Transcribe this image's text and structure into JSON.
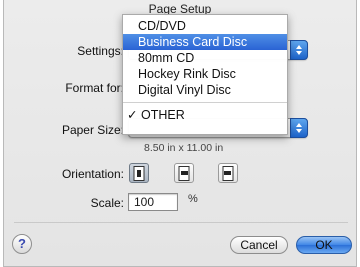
{
  "window": {
    "title": "Page Setup"
  },
  "settings": {
    "label": "Settings:"
  },
  "format_for": {
    "label": "Format for:"
  },
  "paper_size": {
    "label": "Paper Size:",
    "dimensions": "8.50 in x 11.00 in"
  },
  "menu": {
    "items": [
      {
        "label": "CD/DVD"
      },
      {
        "label": "Business Card Disc"
      },
      {
        "label": "80mm CD"
      },
      {
        "label": "Hockey Rink Disc"
      },
      {
        "label": "Digital Vinyl Disc"
      }
    ],
    "checked_item": {
      "check": "✓",
      "label": "OTHER"
    }
  },
  "orientation": {
    "label": "Orientation:"
  },
  "scale": {
    "label": "Scale:",
    "value": "100",
    "unit": "%"
  },
  "buttons": {
    "help": "?",
    "cancel": "Cancel",
    "ok": "OK"
  },
  "colors": {
    "accent": "#2a63d4"
  }
}
